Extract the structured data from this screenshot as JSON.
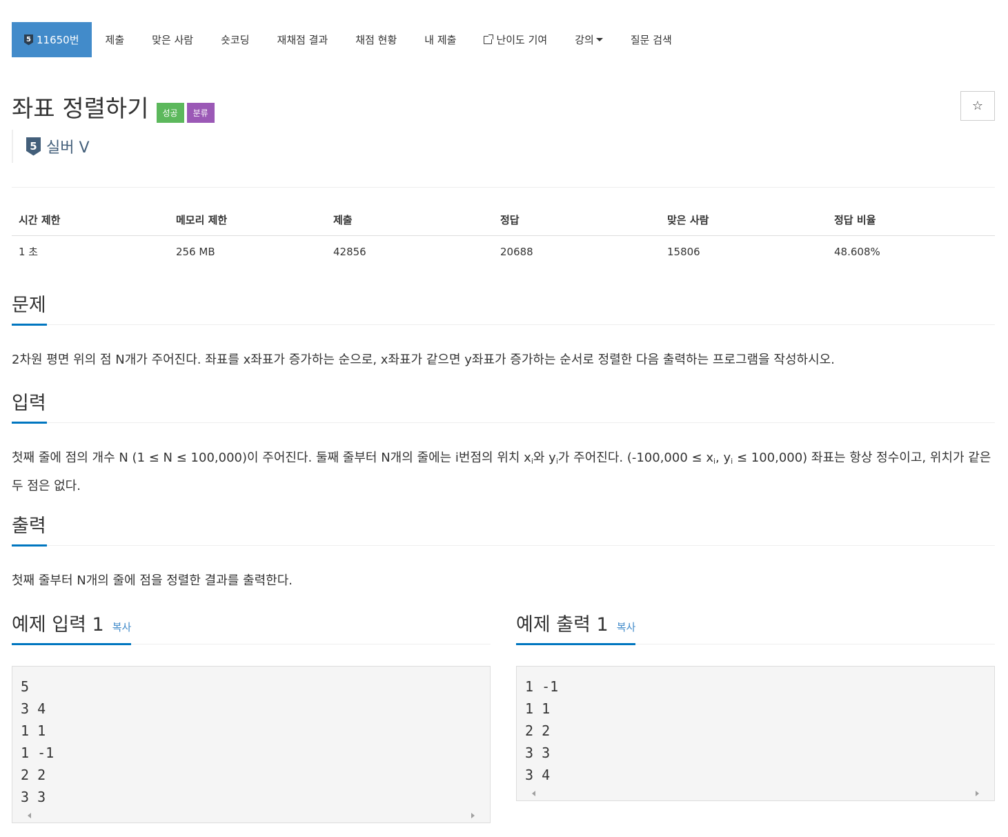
{
  "nav": {
    "problem_tier": "5",
    "problem_id": "11650번",
    "items": [
      "제출",
      "맞은 사람",
      "숏코딩",
      "재채점 결과",
      "채점 현황",
      "내 제출",
      "난이도 기여",
      "강의",
      "질문 검색"
    ]
  },
  "problem": {
    "title": "좌표 정렬하기",
    "label_success": "성공",
    "label_category": "분류",
    "star": "☆",
    "tier_number": "5",
    "tier_name": "실버 V"
  },
  "stats": {
    "headers": [
      "시간 제한",
      "메모리 제한",
      "제출",
      "정답",
      "맞은 사람",
      "정답 비율"
    ],
    "values": [
      "1 초",
      "256 MB",
      "42856",
      "20688",
      "15806",
      "48.608%"
    ]
  },
  "description": {
    "heading": "문제",
    "text": "2차원 평면 위의 점 N개가 주어진다. 좌표를 x좌표가 증가하는 순으로, x좌표가 같으면 y좌표가 증가하는 순서로 정렬한 다음 출력하는 프로그램을 작성하시오."
  },
  "input": {
    "heading": "입력",
    "part1": "첫째 줄에 점의 개수 N (1 ≤ N ≤ 100,000)이 주어진다. 둘째 줄부터 N개의 줄에는 i번점의 위치 x",
    "sub1": "i",
    "part2": "와 y",
    "sub2": "i",
    "part3": "가 주어진다. (-100,000 ≤ x",
    "sub3": "i",
    "part4": ", y",
    "sub4": "i",
    "part5": " ≤ 100,000) 좌표는 항상 정수이고, 위치가 같은 두 점은 없다."
  },
  "output": {
    "heading": "출력",
    "text": "첫째 줄부터 N개의 줄에 점을 정렬한 결과를 출력한다."
  },
  "sample_input": {
    "heading": "예제 입력 1",
    "copy": "복사",
    "lines": [
      "5",
      "3 4",
      "1 1",
      "1 -1",
      "2 2",
      "3 3"
    ]
  },
  "sample_output": {
    "heading": "예제 출력 1",
    "copy": "복사",
    "lines": [
      "1 -1",
      "1 1",
      "2 2",
      "3 3",
      "3 4"
    ]
  }
}
